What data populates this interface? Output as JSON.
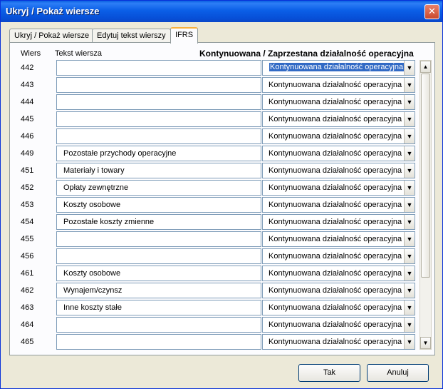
{
  "window": {
    "title": "Ukryj / Pokaż wiersze",
    "close_symbol": "✕"
  },
  "tabs": [
    {
      "label": "Ukryj / Pokaż wiersze",
      "active": false
    },
    {
      "label": "Edytuj tekst wierszy",
      "active": false
    },
    {
      "label": "IFRS",
      "active": true
    }
  ],
  "table": {
    "headers": {
      "row": "Wiers",
      "text": "Tekst wiersza",
      "status": "Kontynuowana / Zaprzestana działalność operacyjna"
    },
    "rows": [
      {
        "num": "442",
        "text": "",
        "status": "Kontynuowana działalność operacyjna",
        "selected": true
      },
      {
        "num": "443",
        "text": "",
        "status": "Kontynuowana działalność operacyjna"
      },
      {
        "num": "444",
        "text": "",
        "status": "Kontynuowana działalność operacyjna"
      },
      {
        "num": "445",
        "text": "",
        "status": "Kontynuowana działalność operacyjna"
      },
      {
        "num": "446",
        "text": "",
        "status": "Kontynuowana działalność operacyjna"
      },
      {
        "num": "449",
        "text": "Pozostałe przychody operacyjne",
        "status": "Kontynuowana działalność operacyjna"
      },
      {
        "num": "451",
        "text": "Materiały i towary",
        "status": "Kontynuowana działalność operacyjna"
      },
      {
        "num": "452",
        "text": "Opłaty zewnętrzne",
        "status": "Kontynuowana działalność operacyjna"
      },
      {
        "num": "453",
        "text": "Koszty osobowe",
        "status": "Kontynuowana działalność operacyjna"
      },
      {
        "num": "454",
        "text": "Pozostałe koszty zmienne",
        "status": "Kontynuowana działalność operacyjna"
      },
      {
        "num": "455",
        "text": "",
        "status": "Kontynuowana działalność operacyjna"
      },
      {
        "num": "456",
        "text": "",
        "status": "Kontynuowana działalność operacyjna"
      },
      {
        "num": "461",
        "text": "Koszty osobowe",
        "status": "Kontynuowana działalność operacyjna"
      },
      {
        "num": "462",
        "text": "Wynajem/czynsz",
        "status": "Kontynuowana działalność operacyjna"
      },
      {
        "num": "463",
        "text": "Inne koszty stałe",
        "status": "Kontynuowana działalność operacyjna"
      },
      {
        "num": "464",
        "text": "",
        "status": "Kontynuowana działalność operacyjna"
      },
      {
        "num": "465",
        "text": "",
        "status": "Kontynuowana działalność operacyjna"
      }
    ]
  },
  "icons": {
    "dropdown": "▼",
    "scroll_up": "▲",
    "scroll_down": "▼"
  },
  "buttons": {
    "ok": "Tak",
    "cancel": "Anuluj"
  }
}
